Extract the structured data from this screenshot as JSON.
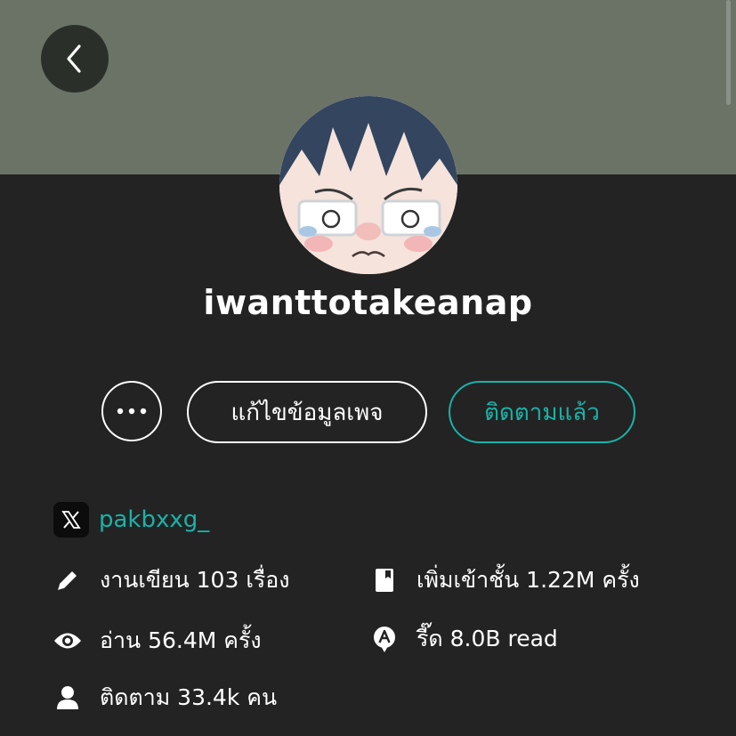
{
  "profile": {
    "username": "iwanttotakeanap"
  },
  "actions": {
    "more_label": "•••",
    "edit_label": "แก้ไขข้อมูลเพจ",
    "follow_label": "ติดตามแล้ว"
  },
  "social": {
    "platform_icon": "x-icon",
    "handle": "pakbxxg_"
  },
  "stats": {
    "works": "งานเขียน 103 เรื่อง",
    "library": "เพิ่มเข้าชั้น 1.22M ครั้ง",
    "reads": "อ่าน 56.4M ครั้ง",
    "read_badge": "รี๊ด 8.0B read",
    "followers": "ติดตาม 33.4k คน"
  },
  "colors": {
    "accent": "#1ab2a8",
    "cover": "#6b7367",
    "background": "#232323"
  }
}
